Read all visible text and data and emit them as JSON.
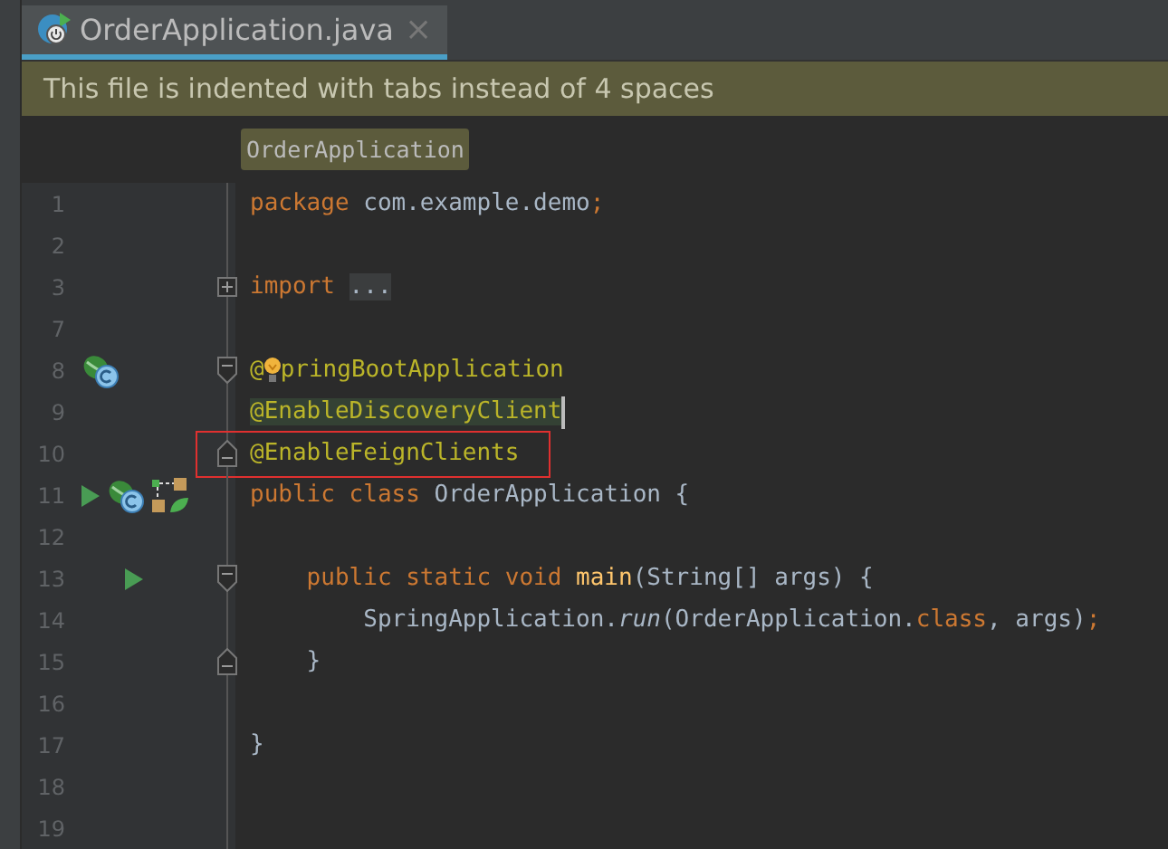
{
  "tab": {
    "title": "OrderApplication.java",
    "close": "×",
    "selected": true
  },
  "notification": {
    "text": "This file is indented with tabs instead of 4 spaces"
  },
  "breadcrumb": {
    "label": "OrderApplication"
  },
  "lines": [
    {
      "number": "1",
      "tokens": [
        {
          "kind": "keyword",
          "text": "package "
        },
        {
          "kind": "plain",
          "text": "com.example.demo"
        },
        {
          "kind": "keyword",
          "text": ";"
        }
      ]
    },
    {
      "number": "2"
    },
    {
      "number": "3",
      "fold": {
        "kind": "expand"
      },
      "tokens": [
        {
          "kind": "keyword",
          "text": "import "
        },
        {
          "kind": "folded",
          "text": "..."
        }
      ]
    },
    {
      "number": "7"
    },
    {
      "number": "8",
      "fold": {
        "kind": "start"
      },
      "icons": [
        {
          "kind": "bean"
        }
      ],
      "bulb": true,
      "tokens": [
        {
          "kind": "annotation",
          "text": "@"
        },
        {
          "kind": "annotation",
          "text": "pringBootApplication"
        }
      ]
    },
    {
      "number": "9",
      "highlighted": true,
      "caret": true,
      "tokens": [
        {
          "kind": "annotation",
          "text": "@EnableDiscoveryClient"
        }
      ]
    },
    {
      "number": "10",
      "fold": {
        "kind": "end"
      },
      "boxed": true,
      "tokens": [
        {
          "kind": "annotation",
          "text": "@EnableFeignClients"
        }
      ]
    },
    {
      "number": "11",
      "icons": [
        {
          "kind": "run"
        },
        {
          "kind": "bean"
        },
        {
          "kind": "graph"
        }
      ],
      "tokens": [
        {
          "kind": "keyword",
          "text": "public class "
        },
        {
          "kind": "plain",
          "text": "OrderApplication {"
        }
      ]
    },
    {
      "number": "12"
    },
    {
      "number": "13",
      "fold": {
        "kind": "start"
      },
      "icons": [
        {
          "kind": "run"
        }
      ],
      "tokens": [
        {
          "kind": "keyword",
          "text": "    public static void "
        },
        {
          "kind": "method",
          "text": "main"
        },
        {
          "kind": "plain",
          "text": "(String[] args) {"
        }
      ]
    },
    {
      "number": "14",
      "tokens": [
        {
          "kind": "plain",
          "text": "        SpringApplication."
        },
        {
          "kind": "italic",
          "text": "run"
        },
        {
          "kind": "plain",
          "text": "(OrderApplication."
        },
        {
          "kind": "keyword",
          "text": "class"
        },
        {
          "kind": "plain",
          "text": ", args)"
        },
        {
          "kind": "keyword",
          "text": ";"
        }
      ]
    },
    {
      "number": "15",
      "fold": {
        "kind": "end"
      },
      "tokens": [
        {
          "kind": "plain",
          "text": "    }"
        }
      ]
    },
    {
      "number": "16"
    },
    {
      "number": "17",
      "tokens": [
        {
          "kind": "plain",
          "text": "}"
        }
      ]
    },
    {
      "number": "18"
    },
    {
      "number": "19"
    }
  ]
}
